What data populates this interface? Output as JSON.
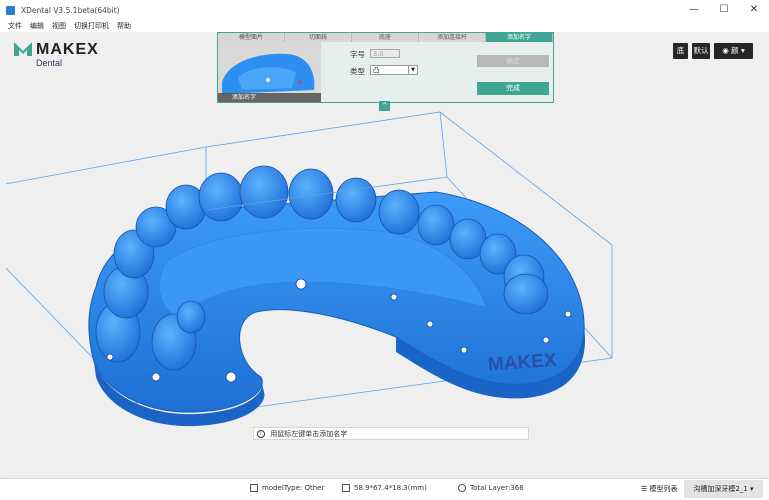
{
  "window": {
    "title": "XDental V3.5.1beta(64bit)",
    "controls": [
      "—",
      "☐",
      "✕"
    ]
  },
  "menu": [
    "文件",
    "编辑",
    "视图",
    "切换打印机",
    "帮助"
  ],
  "logo": {
    "brand": "MAKEX",
    "sub": "Dental"
  },
  "wizard": {
    "steps": [
      {
        "label": "模型面片",
        "active": false
      },
      {
        "label": "切面线",
        "active": false
      },
      {
        "label": "底座",
        "active": false
      },
      {
        "label": "添加连接杆",
        "active": false
      },
      {
        "label": "添加名字",
        "active": true
      }
    ],
    "thumbnail_caption": "添加名字",
    "font_size_label": "字号",
    "font_size_value": "3.0",
    "type_label": "类型",
    "type_value": "凸",
    "confirm_label": "确定",
    "finish_label": "完成",
    "collapse_glyph": "^"
  },
  "toolbar": {
    "btn1": "底",
    "btn2": "默认",
    "eye_glyph": "◉",
    "view_label": "颜 ▾"
  },
  "model": {
    "embossed_text": "MAKEX",
    "color": "#2e8ef2"
  },
  "hint": {
    "icon": "i",
    "text": "用鼠标左键单击添加名字"
  },
  "status": {
    "model_type": "modelType: Other",
    "size": "58.9*67.4*18.3(mm)",
    "total_layer": "Total Layer:366",
    "model_list_tab": "模型列表",
    "active_tab": "沟槽加深牙模2_1 ▾"
  }
}
